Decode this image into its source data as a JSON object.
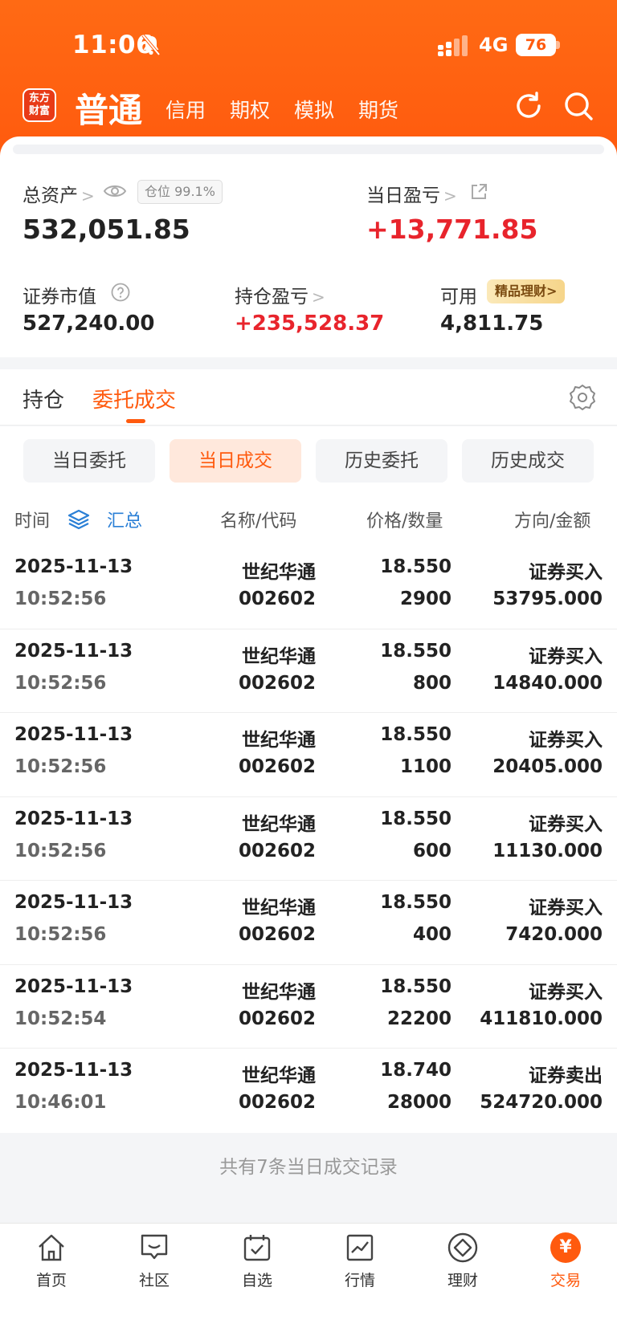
{
  "status_bar": {
    "time": "11:06",
    "network": "4G",
    "battery": "76"
  },
  "nav": {
    "logo": "东方财富",
    "main": "普通",
    "tabs": [
      "信用",
      "期权",
      "模拟",
      "期货"
    ]
  },
  "summary": {
    "total_assets_label": "总资产",
    "position_badge": "仓位 99.1%",
    "total_assets_value": "532,051.85",
    "daily_pnl_label": "当日盈亏",
    "daily_pnl_value": "+13,771.85",
    "market_value_label": "证券市值",
    "market_value": "527,240.00",
    "holding_pnl_label": "持仓盈亏",
    "holding_pnl_value": "+235,528.37",
    "available_label": "可用",
    "wealth_badge": "精品理财>",
    "available_value": "4,811.75"
  },
  "tabs": {
    "holdings": "持仓",
    "orders": "委托成交"
  },
  "segments": [
    "当日委托",
    "当日成交",
    "历史委托",
    "历史成交"
  ],
  "table_header": {
    "time": "时间",
    "summary": "汇总",
    "name_code": "名称/代码",
    "price_qty": "价格/数量",
    "direction_amount": "方向/金额"
  },
  "rows": [
    {
      "date": "2025-11-13",
      "time": "10:52:56",
      "name": "世纪华通",
      "code": "002602",
      "price": "18.550",
      "qty": "2900",
      "direction": "证券买入",
      "amount": "53795.000"
    },
    {
      "date": "2025-11-13",
      "time": "10:52:56",
      "name": "世纪华通",
      "code": "002602",
      "price": "18.550",
      "qty": "800",
      "direction": "证券买入",
      "amount": "14840.000"
    },
    {
      "date": "2025-11-13",
      "time": "10:52:56",
      "name": "世纪华通",
      "code": "002602",
      "price": "18.550",
      "qty": "1100",
      "direction": "证券买入",
      "amount": "20405.000"
    },
    {
      "date": "2025-11-13",
      "time": "10:52:56",
      "name": "世纪华通",
      "code": "002602",
      "price": "18.550",
      "qty": "600",
      "direction": "证券买入",
      "amount": "11130.000"
    },
    {
      "date": "2025-11-13",
      "time": "10:52:56",
      "name": "世纪华通",
      "code": "002602",
      "price": "18.550",
      "qty": "400",
      "direction": "证券买入",
      "amount": "7420.000"
    },
    {
      "date": "2025-11-13",
      "time": "10:52:54",
      "name": "世纪华通",
      "code": "002602",
      "price": "18.550",
      "qty": "22200",
      "direction": "证券买入",
      "amount": "411810.000"
    },
    {
      "date": "2025-11-13",
      "time": "10:46:01",
      "name": "世纪华通",
      "code": "002602",
      "price": "18.740",
      "qty": "28000",
      "direction": "证券卖出",
      "amount": "524720.000"
    }
  ],
  "footer_note": "共有7条当日成交记录",
  "bottom_nav": [
    "首页",
    "社区",
    "自选",
    "行情",
    "理财",
    "交易"
  ],
  "colors": {
    "brand": "#ff5a0e",
    "rise": "#e8242c",
    "fall": "#13a03a",
    "link": "#2a7fd6"
  }
}
